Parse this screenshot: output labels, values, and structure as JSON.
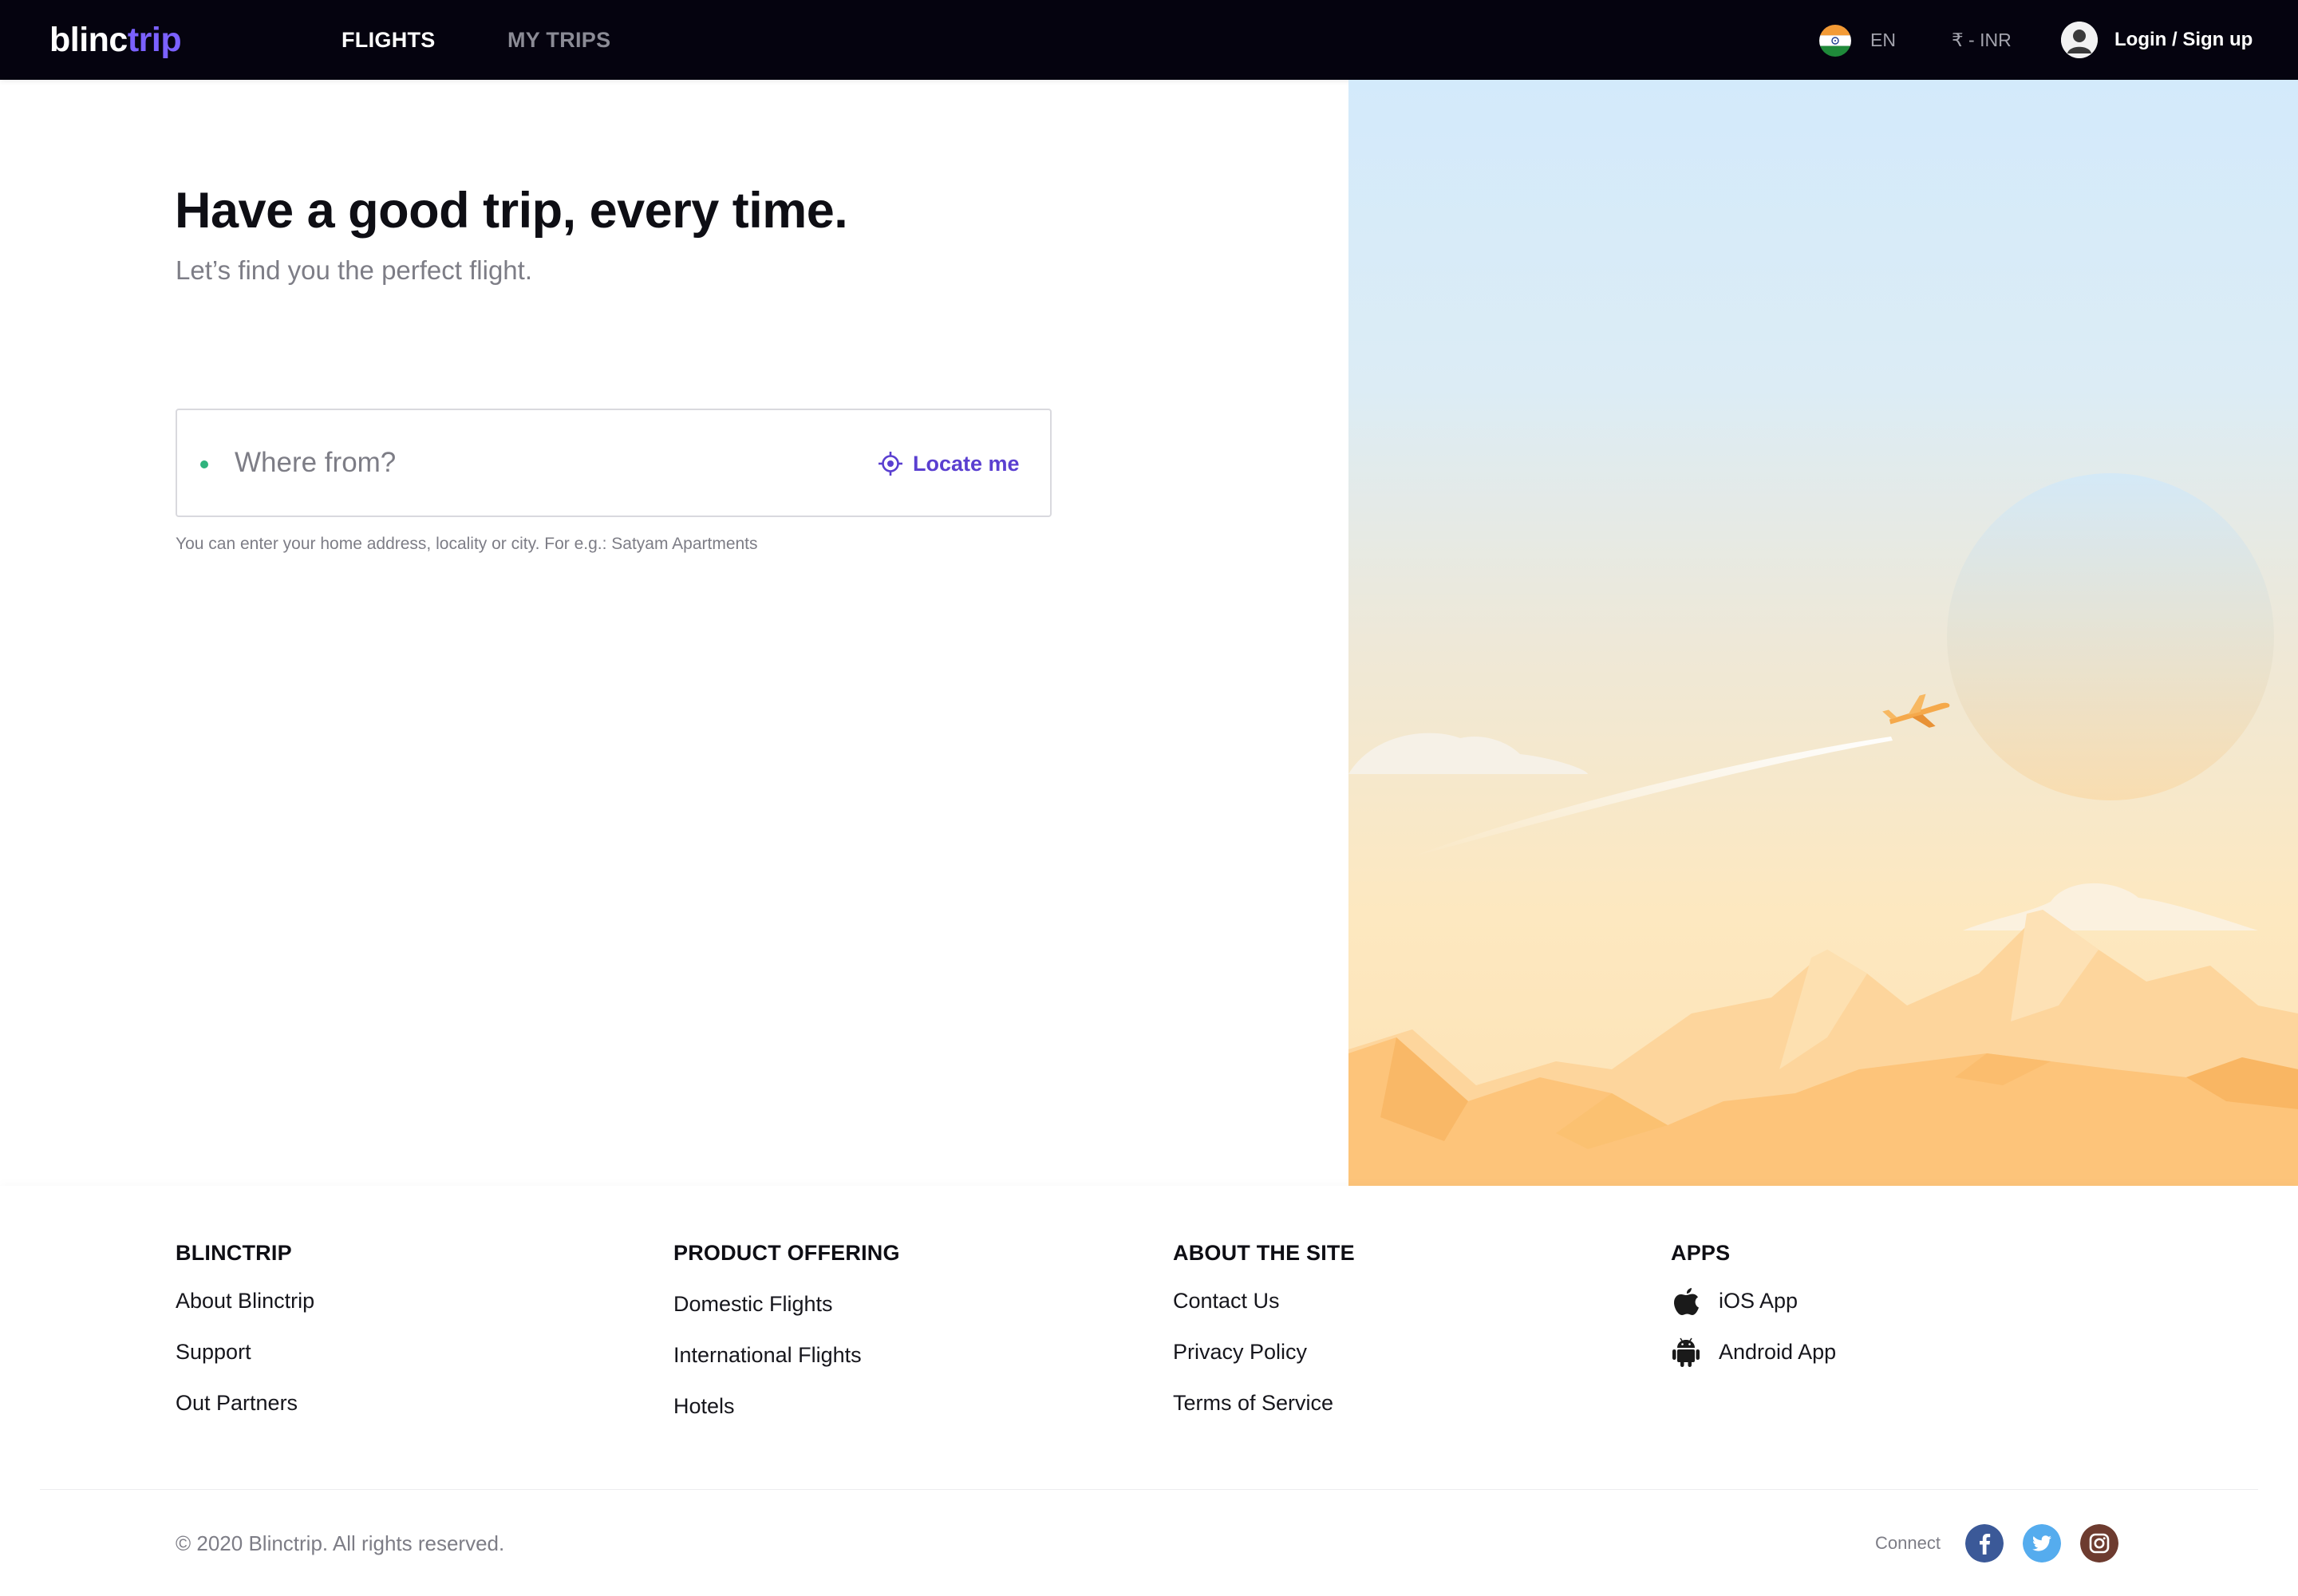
{
  "nav": {
    "logo_part1": "blinc",
    "logo_part2": "trip",
    "tabs": [
      {
        "label": "FLIGHTS",
        "active": true
      },
      {
        "label": "MY TRIPS",
        "active": false
      }
    ],
    "language": "EN",
    "currency": "₹ - INR",
    "login_label": "Login / Sign up"
  },
  "hero": {
    "title": "Have a good trip, every time.",
    "subtitle": "Let’s find you the perfect flight.",
    "search": {
      "placeholder": "Where from?",
      "value": "",
      "locate_label": "Locate me",
      "hint": "You can enter your home address, locality or city. For e.g.: Satyam Apartments"
    }
  },
  "footer": {
    "columns": [
      {
        "heading": "BLINCTRIP",
        "links": [
          "About Blinctrip",
          "Support",
          "Out Partners"
        ]
      },
      {
        "heading": "PRODUCT OFFERING",
        "links": [
          "Domestic Flights",
          "International Flights",
          "Hotels"
        ]
      },
      {
        "heading": "ABOUT THE SITE",
        "links": [
          "Contact Us",
          "Privacy Policy",
          "Terms of Service"
        ]
      },
      {
        "heading": "APPS",
        "links": [
          "iOS App",
          "Android App"
        ]
      }
    ],
    "copyright": "© 2020 Blinctrip. All rights reserved.",
    "connect_label": "Connect",
    "social": [
      "facebook-icon",
      "twitter-icon",
      "instagram-icon"
    ]
  },
  "colors": {
    "nav_bg": "#05030f",
    "brand_accent": "#7b61ff",
    "locate_accent": "#5a3fd0",
    "dot_green": "#2fb37d",
    "sky_top": "#d3eafb",
    "sand": "#fdc47a",
    "facebook": "#3b5998",
    "twitter": "#55acee",
    "instagram": "#6d3b2f"
  }
}
